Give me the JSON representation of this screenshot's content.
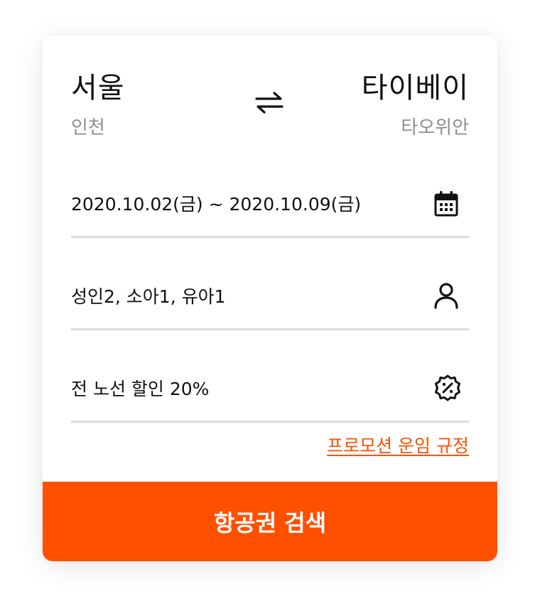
{
  "route": {
    "origin_city": "서울",
    "origin_airport": "인천",
    "destination_city": "타이베이",
    "destination_airport": "타오위안",
    "swap_icon": "swap-arrows-icon"
  },
  "fields": {
    "dates": {
      "value": "2020.10.02(금) ~ 2020.10.09(금)",
      "icon": "calendar-icon"
    },
    "passengers": {
      "value": "성인2, 소아1, 유아1",
      "icon": "person-icon"
    },
    "promotion": {
      "value": "전 노선 할인 20%",
      "icon": "discount-badge-icon"
    }
  },
  "promo_rules_link": "프로모션 운임 규정",
  "search_button_label": "항공권 검색",
  "colors": {
    "accent": "#ff5000",
    "divider": "#dcdcdc",
    "muted_text": "#8e8e8e",
    "text": "#111111"
  }
}
